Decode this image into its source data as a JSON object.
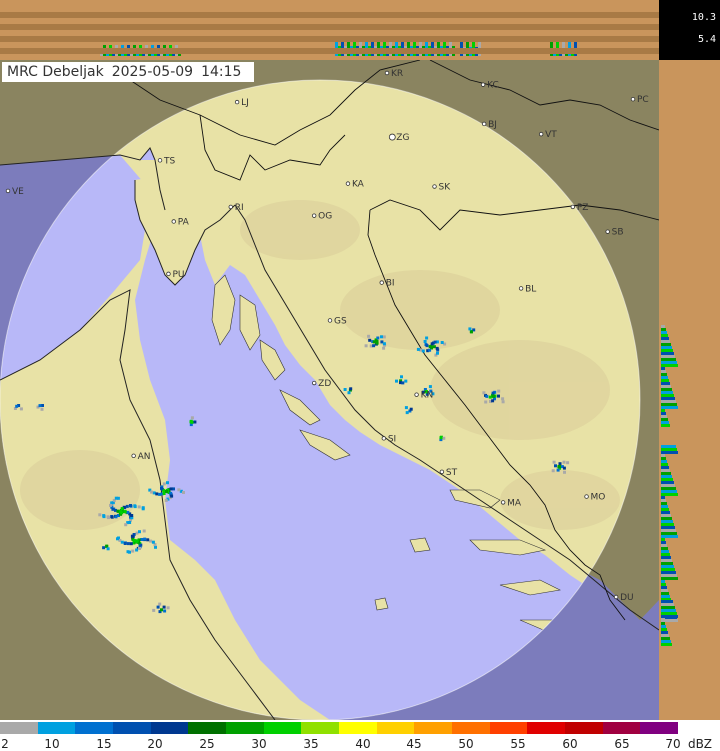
{
  "header": {
    "station": "MRC Debeljak",
    "date": "2025-05-09",
    "time": "14:15"
  },
  "height_scale": {
    "top": "10.3",
    "bottom": "5.4"
  },
  "cities": [
    {
      "code": "LJ",
      "lon": 14.5,
      "lat": 46.05
    },
    {
      "code": "KR",
      "lon": 15.92,
      "lat": 46.25
    },
    {
      "code": "KC",
      "lon": 16.83,
      "lat": 46.17
    },
    {
      "code": "PC",
      "lon": 18.25,
      "lat": 46.07
    },
    {
      "code": "TS",
      "lon": 13.77,
      "lat": 45.65
    },
    {
      "code": "ZG",
      "lon": 15.97,
      "lat": 45.81
    },
    {
      "code": "BJ",
      "lon": 16.84,
      "lat": 45.9
    },
    {
      "code": "VT",
      "lon": 17.38,
      "lat": 45.83
    },
    {
      "code": "VE",
      "lon": 12.33,
      "lat": 45.44
    },
    {
      "code": "KA",
      "lon": 15.55,
      "lat": 45.49
    },
    {
      "code": "SK",
      "lon": 16.37,
      "lat": 45.47
    },
    {
      "code": "RI",
      "lon": 14.44,
      "lat": 45.33
    },
    {
      "code": "PZ",
      "lon": 17.68,
      "lat": 45.33
    },
    {
      "code": "PA",
      "lon": 13.9,
      "lat": 45.23
    },
    {
      "code": "OG",
      "lon": 15.23,
      "lat": 45.27
    },
    {
      "code": "SB",
      "lon": 18.01,
      "lat": 45.16
    },
    {
      "code": "PU",
      "lon": 13.85,
      "lat": 44.87
    },
    {
      "code": "BI",
      "lon": 15.87,
      "lat": 44.81
    },
    {
      "code": "BL",
      "lon": 17.19,
      "lat": 44.77
    },
    {
      "code": "GS",
      "lon": 15.38,
      "lat": 44.55
    },
    {
      "code": "KN",
      "lon": 16.2,
      "lat": 44.04
    },
    {
      "code": "ZD",
      "lon": 15.23,
      "lat": 44.12
    },
    {
      "code": "AN",
      "lon": 13.52,
      "lat": 43.62
    },
    {
      "code": "SI",
      "lon": 15.89,
      "lat": 43.74
    },
    {
      "code": "ST",
      "lon": 16.44,
      "lat": 43.51
    },
    {
      "code": "MO",
      "lon": 17.81,
      "lat": 43.34
    },
    {
      "code": "MA",
      "lon": 17.02,
      "lat": 43.3
    },
    {
      "code": "DU",
      "lon": 18.09,
      "lat": 42.65
    }
  ],
  "legend": {
    "unit": "dBZ",
    "labels": [
      "2",
      "10",
      "15",
      "20",
      "25",
      "30",
      "35",
      "40",
      "45",
      "50",
      "55",
      "60",
      "65",
      "70"
    ],
    "colors": [
      "#a9a9a9",
      "#00a0e0",
      "#0070d0",
      "#0050b0",
      "#003890",
      "#007000",
      "#00a000",
      "#00d000",
      "#90e000",
      "#ffff00",
      "#ffd000",
      "#ffa000",
      "#ff7000",
      "#ff4000",
      "#e00000",
      "#c00000",
      "#a00040",
      "#800080"
    ]
  },
  "colors": {
    "sea": "#b8b8f8",
    "land_in_range": "#e8e2a6",
    "land_out_range": "#8a8460",
    "sea_out_range": "#7c7cbc",
    "profile_panel": "#c9955c"
  }
}
